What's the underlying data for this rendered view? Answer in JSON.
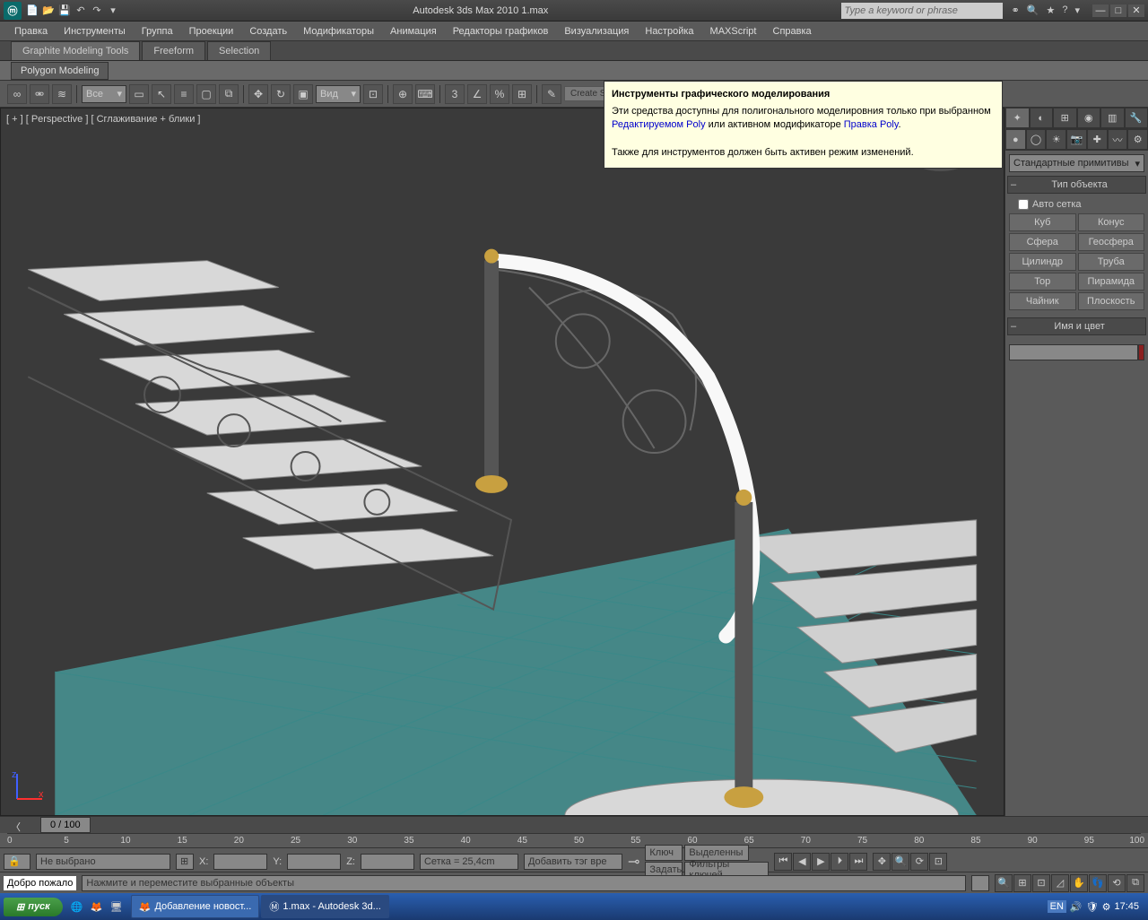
{
  "title": "Autodesk 3ds Max  2010     1.max",
  "search_placeholder": "Type a keyword or phrase",
  "menu": [
    "Правка",
    "Инструменты",
    "Группа",
    "Проекции",
    "Создать",
    "Модификаторы",
    "Анимация",
    "Редакторы графиков",
    "Визуализация",
    "Настройка",
    "MAXScript",
    "Справка"
  ],
  "ribbon": {
    "tabs": [
      "Graphite Modeling Tools",
      "Freeform",
      "Selection"
    ],
    "sub": "Polygon Modeling"
  },
  "toolbar": {
    "dropdown1": "Все",
    "dropdown2": "Вид",
    "create_label": "Create Se"
  },
  "viewport": {
    "label": "[ + ] [ Perspective ] [ Сглаживание + блики ]",
    "axis_z": "z",
    "axis_x": "x"
  },
  "tooltip": {
    "title": "Инструменты графического моделирования",
    "line1a": "Эти средства доступны для полигонального моделировния только при выбранном ",
    "link1": "Редактируемом Poly",
    "line1b": " или активном модификаторе ",
    "link2": "Правка Poly",
    "line1c": ".",
    "line2": "Также для инструментов должен быть активен режим изменений."
  },
  "cmdpanel": {
    "dropdown": "Стандартные примитивы",
    "sect_objtype": "Тип объекта",
    "autogrid": "Авто сетка",
    "buttons": [
      [
        "Куб",
        "Конус"
      ],
      [
        "Сфера",
        "Геосфера"
      ],
      [
        "Цилиндр",
        "Труба"
      ],
      [
        "Тор",
        "Пирамида"
      ],
      [
        "Чайник",
        "Плоскость"
      ]
    ],
    "sect_name": "Имя и цвет"
  },
  "timeline": {
    "frame": "0 / 100",
    "ticks": [
      "0",
      "5",
      "10",
      "15",
      "20",
      "25",
      "30",
      "35",
      "40",
      "45",
      "50",
      "55",
      "60",
      "65",
      "70",
      "75",
      "80",
      "85",
      "90",
      "95",
      "100"
    ]
  },
  "status": {
    "none_selected": "Не выбрано",
    "x_label": "X:",
    "y_label": "Y:",
    "z_label": "Z:",
    "grid": "Сетка = 25,4cm",
    "addtag": "Добавить тэг вре",
    "key": "Ключ",
    "selected": "Выделенны",
    "set": "Задать",
    "filters": "Фильтры ключей"
  },
  "prompt": {
    "welcome": "Добро пожало",
    "hint": "Нажмите и переместите выбранные объекты"
  },
  "taskbar": {
    "start": "пуск",
    "tasks": [
      {
        "label": "Добавление новост..."
      },
      {
        "label": "1.max - Autodesk 3d..."
      }
    ],
    "lang": "EN",
    "time": "17:45"
  }
}
